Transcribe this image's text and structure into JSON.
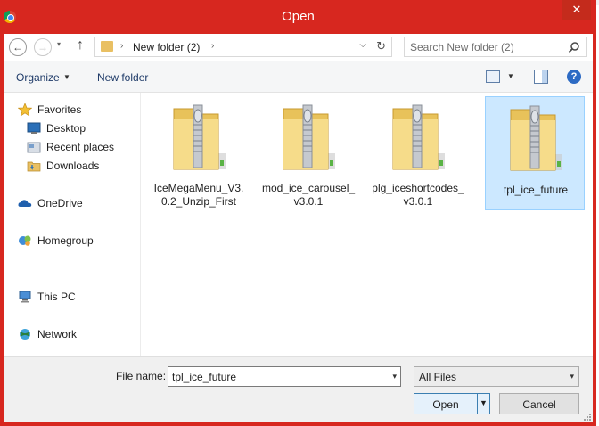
{
  "window": {
    "title": "Open",
    "close_glyph": "✕",
    "accent_color": "#d7271f",
    "icons": {
      "app": "chrome-icon",
      "close": "close-icon"
    }
  },
  "address_bar": {
    "back_glyph": "←",
    "forward_glyph": "→",
    "history_glyph": "▾",
    "up_glyph": "↑",
    "chevron_glyph": "›",
    "dropdown_glyph": "⌵",
    "refresh_glyph": "↻",
    "path": "New folder (2)",
    "icons": {
      "back": "back-arrow-icon",
      "forward": "forward-arrow-icon",
      "up": "up-arrow-icon",
      "folder": "folder-icon",
      "refresh": "refresh-icon"
    }
  },
  "search": {
    "placeholder": "Search New folder (2)",
    "icon": "search-icon"
  },
  "toolbar": {
    "organize_label": "Organize",
    "organize_caret": "▼",
    "new_folder_label": "New folder",
    "view_caret": "▼",
    "help_glyph": "?",
    "icons": {
      "view": "change-view-icon",
      "preview_pane": "preview-pane-icon",
      "help": "help-icon"
    }
  },
  "navigation": {
    "favorites": {
      "label": "Favorites",
      "icon": "star-icon"
    },
    "favorite_items": [
      {
        "label": "Desktop",
        "icon": "desktop-icon"
      },
      {
        "label": "Recent places",
        "icon": "recent-places-icon"
      },
      {
        "label": "Downloads",
        "icon": "downloads-icon"
      }
    ],
    "onedrive": {
      "label": "OneDrive",
      "icon": "cloud-icon"
    },
    "homegroup": {
      "label": "Homegroup",
      "icon": "homegroup-icon"
    },
    "this_pc": {
      "label": "This PC",
      "icon": "computer-icon"
    },
    "network": {
      "label": "Network",
      "icon": "network-icon"
    }
  },
  "files": [
    {
      "name": "IceMegaMenu_V3.0.2_Unzip_First",
      "icon": "zip-folder-icon",
      "selected": false
    },
    {
      "name": "mod_ice_carousel_v3.0.1",
      "icon": "zip-folder-icon",
      "selected": false
    },
    {
      "name": "plg_iceshortcodes_v3.0.1",
      "icon": "zip-folder-icon",
      "selected": false
    },
    {
      "name": "tpl_ice_future",
      "icon": "zip-folder-icon",
      "selected": true
    }
  ],
  "bottom": {
    "file_name_label": "File name:",
    "file_name_value": "tpl_ice_future",
    "file_name_dropdown": "▾",
    "file_type": "All Files",
    "file_type_dropdown": "▾",
    "open_label": "Open",
    "open_caret": "▼",
    "cancel_label": "Cancel"
  }
}
